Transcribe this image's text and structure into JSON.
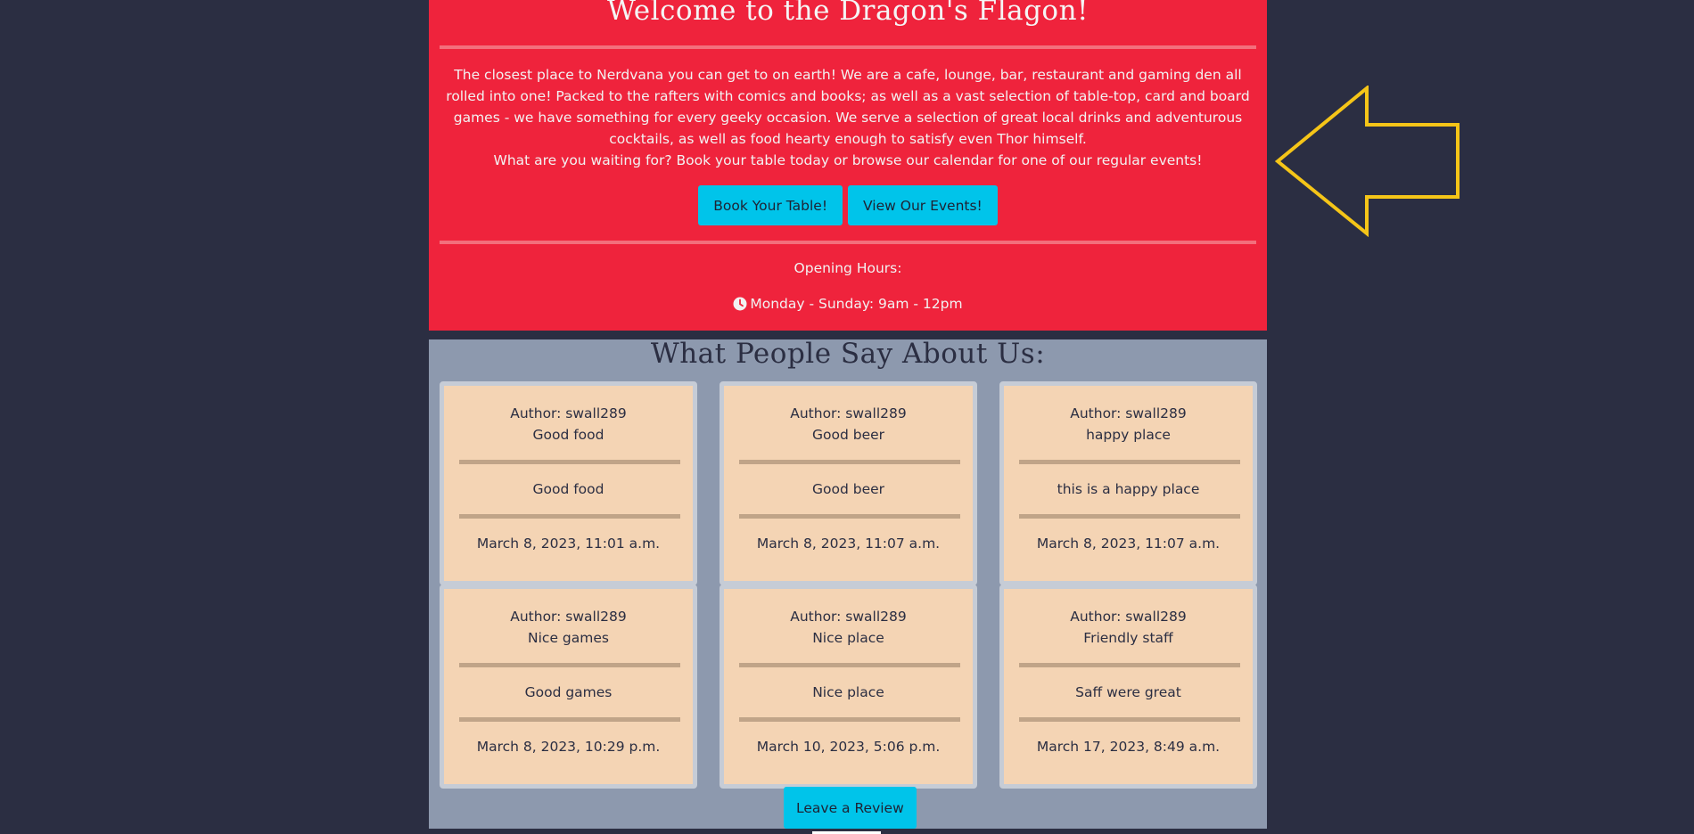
{
  "hero": {
    "title": "Welcome to the Dragon's Flagon!",
    "description": "The closest place to Nerdvana you can get to on earth! We are a cafe, lounge, bar, restaurant and gaming den all rolled into one! Packed to the rafters with comics and books; as well as a vast selection of table-top, card and board games - we have something for every geeky occasion. We serve a selection of great local drinks and adventurous cocktails, as well as food hearty enough to satisfy even Thor himself.",
    "call_to_action": "What are you waiting for? Book your table today or browse our calendar for one of our regular events!",
    "book_button": "Book Your Table!",
    "events_button": "View Our Events!",
    "hours_title": "Opening Hours:",
    "hours": "Monday - Sunday: 9am - 12pm"
  },
  "reviews": {
    "title": "What People Say About Us:",
    "leave_review_button": "Leave a Review",
    "items": [
      {
        "author": "Author: swall289",
        "subject": "Good food",
        "body": "Good food",
        "date": "March 8, 2023, 11:01 a.m."
      },
      {
        "author": "Author: swall289",
        "subject": "Good beer",
        "body": "Good beer",
        "date": "March 8, 2023, 11:07 a.m."
      },
      {
        "author": "Author: swall289",
        "subject": "happy place",
        "body": "this is a happy place",
        "date": "March 8, 2023, 11:07 a.m."
      },
      {
        "author": "Author: swall289",
        "subject": "Nice games",
        "body": "Good games",
        "date": "March 8, 2023, 10:29 p.m."
      },
      {
        "author": "Author: swall289",
        "subject": "Nice place",
        "body": "Nice place",
        "date": "March 10, 2023, 5:06 p.m."
      },
      {
        "author": "Author: swall289",
        "subject": "Friendly staff",
        "body": "Saff were great",
        "date": "March 17, 2023, 8:49 a.m."
      }
    ]
  },
  "colors": {
    "page_background": "#2b2e42",
    "hero_background": "#ef233c",
    "reviews_background": "#8d99ae",
    "card_background": "#f4d4b4",
    "button": "#00c4ea",
    "arrow_outline": "#f5c518"
  },
  "icons": {
    "hours": "clock-icon",
    "pointer": "arrow-left-outline-icon"
  }
}
